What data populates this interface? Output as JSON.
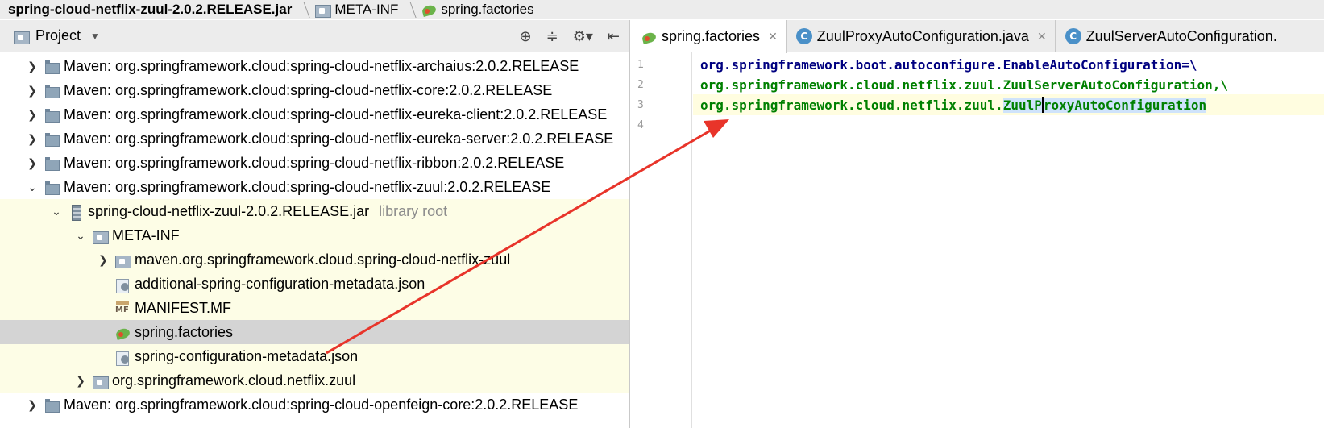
{
  "breadcrumb": {
    "jar": "spring-cloud-netflix-zuul-2.0.2.RELEASE.jar",
    "folder": "META-INF",
    "file": "spring.factories"
  },
  "project_panel": {
    "title": "Project",
    "items": [
      {
        "label": "Maven: org.springframework.cloud:spring-cloud-netflix-archaius:2.0.2.RELEASE"
      },
      {
        "label": "Maven: org.springframework.cloud:spring-cloud-netflix-core:2.0.2.RELEASE"
      },
      {
        "label": "Maven: org.springframework.cloud:spring-cloud-netflix-eureka-client:2.0.2.RELEASE"
      },
      {
        "label": "Maven: org.springframework.cloud:spring-cloud-netflix-eureka-server:2.0.2.RELEASE"
      },
      {
        "label": "Maven: org.springframework.cloud:spring-cloud-netflix-ribbon:2.0.2.RELEASE"
      },
      {
        "label": "Maven: org.springframework.cloud:spring-cloud-netflix-zuul:2.0.2.RELEASE"
      },
      {
        "label": "spring-cloud-netflix-zuul-2.0.2.RELEASE.jar",
        "note": "library root"
      },
      {
        "label": "META-INF"
      },
      {
        "label": "maven.org.springframework.cloud.spring-cloud-netflix-zuul"
      },
      {
        "label": "additional-spring-configuration-metadata.json"
      },
      {
        "label": "MANIFEST.MF"
      },
      {
        "label": "spring.factories"
      },
      {
        "label": "spring-configuration-metadata.json"
      },
      {
        "label": "org.springframework.cloud.netflix.zuul"
      },
      {
        "label": "Maven: org.springframework.cloud:spring-cloud-openfeign-core:2.0.2.RELEASE"
      }
    ]
  },
  "editor": {
    "tabs": [
      {
        "label": "spring.factories"
      },
      {
        "label": "ZuulProxyAutoConfiguration.java"
      },
      {
        "label": "ZuulServerAutoConfiguration."
      }
    ],
    "line_numbers": [
      "1",
      "2",
      "3",
      "4"
    ],
    "lines": {
      "l1": "org.springframework.boot.autoconfigure.EnableAutoConfiguration=\\",
      "l2": "org.springframework.cloud.netflix.zuul.ZuulServerAutoConfiguration,\\",
      "l3_pre": "org.springframework.cloud.netflix.zuul.",
      "l3_sel_a": "ZuulP",
      "l3_sel_b": "roxyAutoConfiguration"
    }
  },
  "colors": {
    "code_key": "#000080",
    "code_value": "#008000",
    "annotation_arrow": "#e8342a",
    "selection": "#cfe3fb"
  }
}
